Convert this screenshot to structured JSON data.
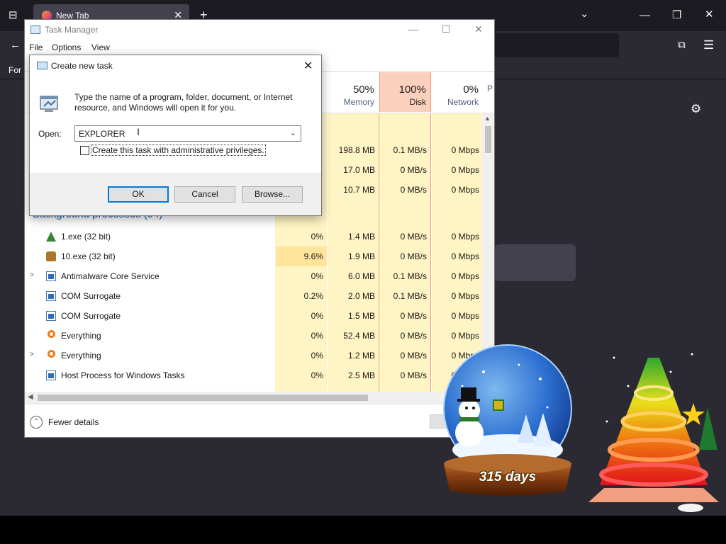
{
  "browser": {
    "tab_title": "New Tab",
    "tab_close": "✕",
    "new_tab": "+",
    "bookmarks_text": "For"
  },
  "task_manager": {
    "title": "Task Manager",
    "menu": [
      "File",
      "Options",
      "View"
    ],
    "columns": [
      {
        "pct": "50%",
        "name": "Memory"
      },
      {
        "pct": "100%",
        "name": "Disk"
      },
      {
        "pct": "0%",
        "name": "Network"
      },
      {
        "pct": "",
        "name": "P"
      }
    ],
    "app_rows": [
      {
        "memory": "198.8 MB",
        "disk": "0.1 MB/s",
        "network": "0 Mbps"
      },
      {
        "memory": "17.0 MB",
        "disk": "0 MB/s",
        "network": "0 Mbps"
      },
      {
        "memory": "10.7 MB",
        "disk": "0 MB/s",
        "network": "0 Mbps"
      }
    ],
    "background_section": "Background processes (94)",
    "processes": [
      {
        "name": "1.exe (32 bit)",
        "icon": "tree-icon",
        "expand": false,
        "cpu": "0%",
        "memory": "1.4 MB",
        "disk": "0 MB/s",
        "network": "0 Mbps",
        "cpu_highlight": false
      },
      {
        "name": "10.exe (32 bit)",
        "icon": "bag-icon",
        "expand": false,
        "cpu": "9.6%",
        "memory": "1.9 MB",
        "disk": "0 MB/s",
        "network": "0 Mbps",
        "cpu_highlight": true
      },
      {
        "name": "Antimalware Core Service",
        "icon": "window-icon",
        "expand": true,
        "cpu": "0%",
        "memory": "6.0 MB",
        "disk": "0.1 MB/s",
        "network": "0 Mbps",
        "cpu_highlight": false
      },
      {
        "name": "COM Surrogate",
        "icon": "window-icon",
        "expand": false,
        "cpu": "0.2%",
        "memory": "2.0 MB",
        "disk": "0.1 MB/s",
        "network": "0 Mbps",
        "cpu_highlight": false
      },
      {
        "name": "COM Surrogate",
        "icon": "window-icon",
        "expand": false,
        "cpu": "0%",
        "memory": "1.5 MB",
        "disk": "0 MB/s",
        "network": "0 Mbps",
        "cpu_highlight": false
      },
      {
        "name": "Everything",
        "icon": "magnifier-icon",
        "expand": false,
        "cpu": "0%",
        "memory": "52.4 MB",
        "disk": "0 MB/s",
        "network": "0 Mbps",
        "cpu_highlight": false
      },
      {
        "name": "Everything",
        "icon": "magnifier-icon",
        "expand": true,
        "cpu": "0%",
        "memory": "1.2 MB",
        "disk": "0 MB/s",
        "network": "0 Mbps",
        "cpu_highlight": false
      },
      {
        "name": "Host Process for Windows Tasks",
        "icon": "window-icon",
        "expand": false,
        "cpu": "0%",
        "memory": "2.5 MB",
        "disk": "0 MB/s",
        "network": "0 Mbps",
        "cpu_highlight": false
      }
    ],
    "fewer_details": "Fewer details"
  },
  "dialog": {
    "title": "Create new task",
    "description": "Type the name of a program, folder, document, or Internet resource, and Windows will open it for you.",
    "open_label": "Open:",
    "open_value": "EXPLORER",
    "admin_label": "Create this task with administrative privileges.",
    "admin_checked": false,
    "ok": "OK",
    "cancel": "Cancel",
    "browse": "Browse..."
  },
  "widget": {
    "days": "315 days"
  }
}
